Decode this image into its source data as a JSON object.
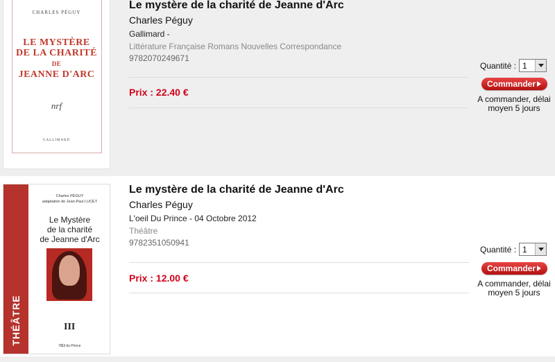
{
  "products": [
    {
      "title": "Le mystère de la charité de Jeanne d'Arc",
      "author": "Charles Péguy",
      "publisher": "Gallimard -",
      "category": "Littérature Française Romans Nouvelles Correspondance",
      "isbn": "9782070249671",
      "price": "Prix : 22.40 €",
      "quantity_label": "Quantité :",
      "quantity_value": "1",
      "order_button": "Commander",
      "availability_line1": "A commander, délai",
      "availability_line2": "moyen 5 jours",
      "cover": {
        "author": "CHARLES PÉGUY",
        "title_line1": "LE MYSTÈRE",
        "title_line2": "DE LA CHARITÉ",
        "title_line3": "DE",
        "title_line4": "JEANNE D'ARC",
        "logo": "nrf",
        "publisher": "GALLIMARD"
      }
    },
    {
      "title": "Le mystère de la charité de Jeanne d'Arc",
      "author": "Charles Péguy",
      "publisher": "L'oeil Du Prince - 04 Octobre 2012",
      "category": "Théâtre",
      "isbn": "9782351050941",
      "price": "Prix : 12.00 €",
      "quantity_label": "Quantité :",
      "quantity_value": "1",
      "order_button": "Commander",
      "availability_line1": "A commander, délai",
      "availability_line2": "moyen 5 jours",
      "cover": {
        "author_line1": "Charles PÉGUY",
        "author_line2": "adaptation de Jean-Paul LUCET",
        "title_line1": "Le Mystère",
        "title_line2": "de la charité",
        "title_line3": "de Jeanne d'Arc",
        "band": "THÉÂTRE",
        "logo": "III",
        "publisher": "l'Œil du Prince"
      }
    }
  ],
  "colors": {
    "price": "#d0021b",
    "button": "#c41a1a",
    "row_alt": "#efefef"
  }
}
